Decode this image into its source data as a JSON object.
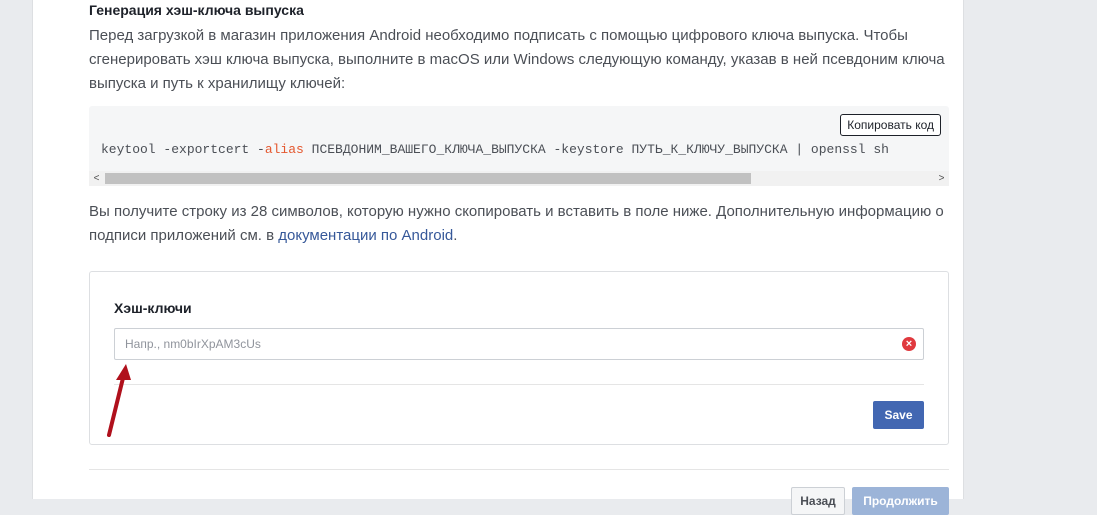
{
  "section": {
    "heading": "Генерация хэш-ключа выпуска",
    "intro": "Перед загрузкой в магазин приложения Android необходимо подписать с помощью цифрового ключа выпуска. Чтобы сгенерировать хэш ключа выпуска, выполните в macOS или Windows следующую команду, указав в ней псевдоним ключа выпуска и путь к хранилищу ключей:"
  },
  "code": {
    "copy_label": "Копировать код",
    "part1": "keytool -exportcert -",
    "keyword": "alias",
    "part2": " ПСЕВДОНИМ_ВАШЕГО_КЛЮЧА_ВЫПУСКА -keystore ПУТЬ_К_КЛЮЧУ_ВЫПУСКА | openssl sh",
    "scroll_left_icon": "chevron-left-icon",
    "scroll_right_icon": "chevron-right-icon"
  },
  "info": {
    "text_before": "Вы получите строку из 28 символов, которую нужно скопировать и вставить в поле ниже. Дополнительную информацию о подписи приложений см. в ",
    "link": "документации по Android",
    "text_after": "."
  },
  "hash_card": {
    "title": "Хэш-ключи",
    "placeholder": "Напр., nm0bIrXpAM3cUs",
    "value": "",
    "clear_icon": "clear-icon",
    "save_label": "Save"
  },
  "footer": {
    "back_label": "Назад",
    "next_label": "Продолжить"
  },
  "colors": {
    "accent": "#4267b2",
    "link": "#365899",
    "error": "#e0393e",
    "annotation_arrow": "#b0101c"
  }
}
